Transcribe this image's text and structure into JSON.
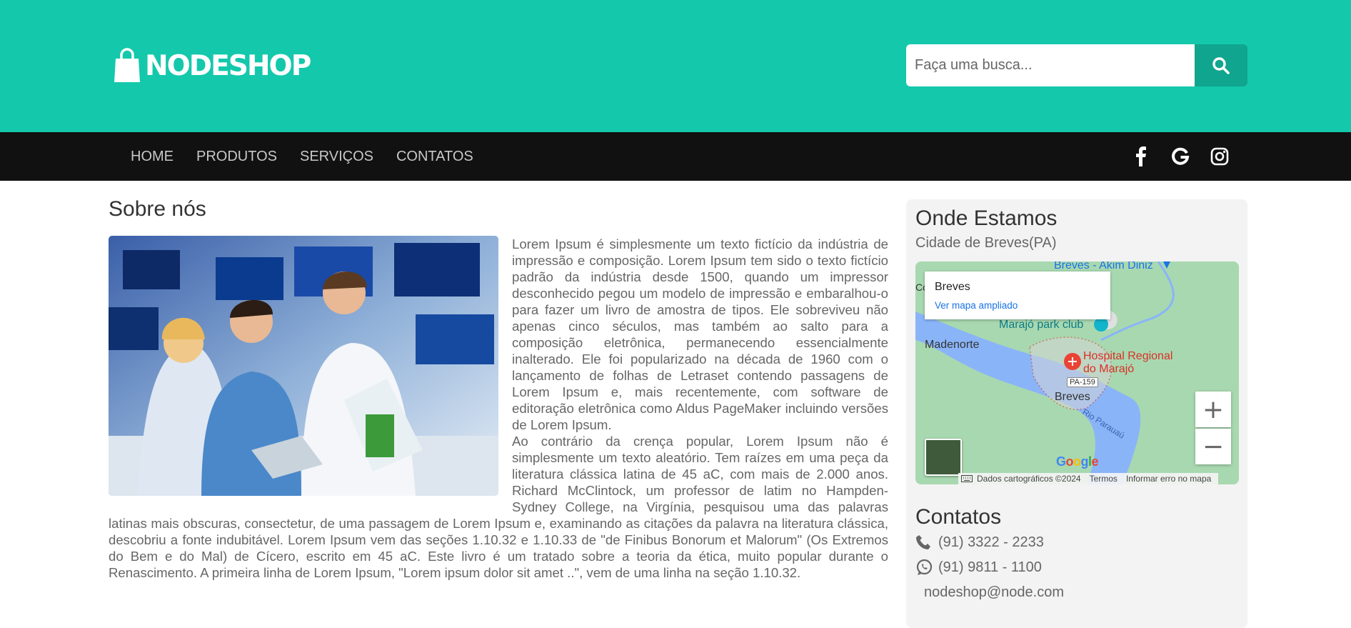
{
  "header": {
    "logo_text": "NODESHOP",
    "search_placeholder": "Faça uma busca...",
    "search_icon": "search-icon"
  },
  "nav": {
    "items": [
      "HOME",
      "PRODUTOS",
      "SERVIÇOS",
      "CONTATOS"
    ],
    "social_icons": [
      "facebook-icon",
      "google-icon",
      "instagram-icon"
    ]
  },
  "about": {
    "title": "Sobre nós",
    "paragraph1": "Lorem Ipsum é simplesmente um texto fictício da indústria de impressão e composição. Lorem Ipsum tem sido o texto fictício padrão da indústria desde 1500, quando um impressor desconhecido pegou um modelo de impressão e embaralhou-o para fazer um livro de amostra de tipos. Ele sobreviveu não apenas cinco séculos, mas também ao salto para a composição eletrônica, permanecendo essencialmente inalterado. Ele foi popularizado na década de 1960 com o lançamento de folhas de Letraset contendo passagens de Lorem Ipsum e, mais recentemente, com software de editoração eletrônica como Aldus PageMaker incluindo versões de Lorem Ipsum.",
    "paragraph2": "Ao contrário da crença popular, Lorem Ipsum não é simplesmente um texto aleatório. Tem raízes em uma peça da literatura clássica latina de 45 aC, com mais de 2.000 anos. Richard McClintock, um professor de latim no Hampden-Sydney College, na Virgínia, pesquisou uma das palavras latinas mais obscuras, consectetur, de uma passagem de Lorem Ipsum e, examinando as citações da palavra na literatura clássica, descobriu a fonte indubitável. Lorem Ipsum vem das seções 1.10.32 e 1.10.33 de \"de Finibus Bonorum et Malorum\" (Os Extremos do Bem e do Mal) de Cícero, escrito em 45 aC. Este livro é um tratado sobre a teoria da ética, muito popular durante o Renascimento. A primeira linha de Lorem Ipsum, \"Lorem ipsum dolor sit amet ..\", vem de uma linha na seção 1.10.32."
  },
  "location": {
    "title": "Onde Estamos",
    "subtitle": "Cidade de Breves(PA)",
    "map": {
      "card_title": "Breves",
      "card_link": "Ver mapa ampliado",
      "labels": {
        "top": "Breves - Akim Diniz",
        "edge": "Co",
        "park": "Marajó park club",
        "town1": "Madenorte",
        "hospital_line1": "Hospital Regional",
        "hospital_line2": "do Marajó",
        "road": "PA-159",
        "city": "Breves",
        "river": "Rio Parauaú"
      },
      "zoom_in": "+",
      "zoom_out": "−",
      "google": [
        "G",
        "o",
        "o",
        "g",
        "l",
        "e"
      ],
      "footer": {
        "data": "Dados cartográficos ©2024",
        "terms": "Termos",
        "report": "Informar erro no mapa"
      }
    }
  },
  "contacts": {
    "title": "Contatos",
    "phone": "(91) 3322 - 2233",
    "whatsapp": "(91) 9811 - 1100",
    "email": "nodeshop@node.com"
  },
  "colors": {
    "header_bg": "#14c8ab",
    "search_button": "#10a58e",
    "navbar_bg": "#111111",
    "sidebar_bg": "#f3f3f3"
  }
}
